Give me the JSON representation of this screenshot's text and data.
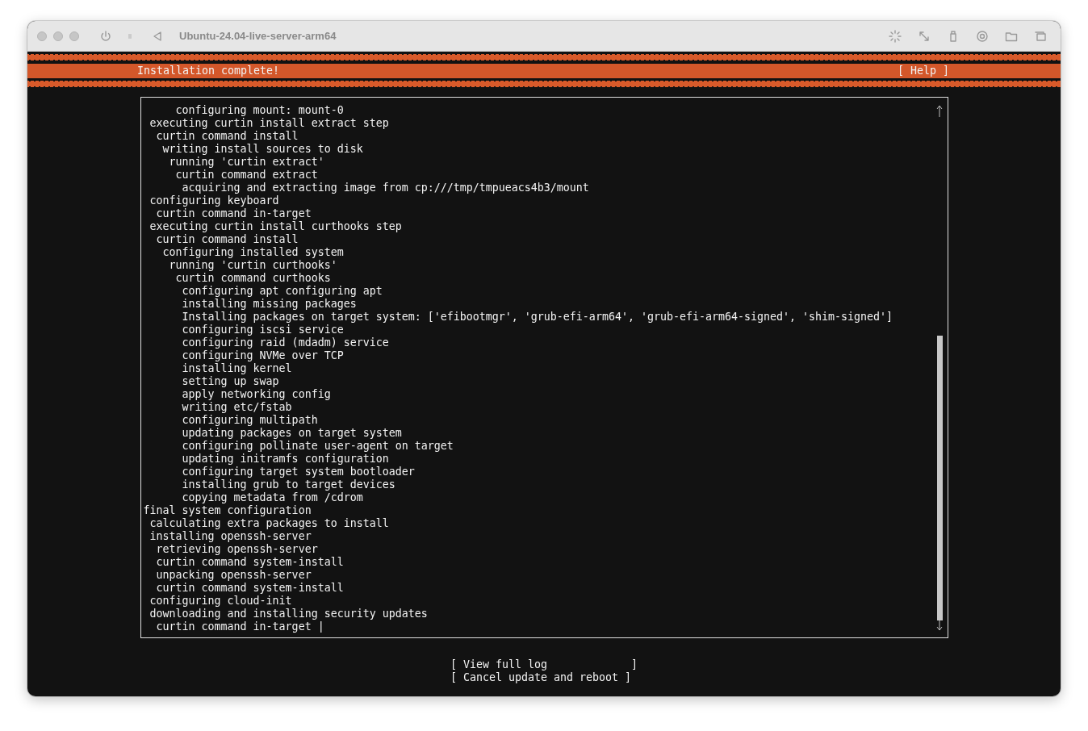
{
  "window": {
    "title": "Ubuntu-24.04-live-server-arm64"
  },
  "header": {
    "title": "Installation complete!",
    "help": "[ Help ]"
  },
  "log": {
    "lines": [
      "     configuring mount: mount-0",
      " executing curtin install extract step",
      "  curtin command install",
      "   writing install sources to disk",
      "    running 'curtin extract'",
      "     curtin command extract",
      "      acquiring and extracting image from cp:///tmp/tmpueacs4b3/mount",
      " configuring keyboard",
      "  curtin command in-target",
      " executing curtin install curthooks step",
      "  curtin command install",
      "   configuring installed system",
      "    running 'curtin curthooks'",
      "     curtin command curthooks",
      "      configuring apt configuring apt",
      "      installing missing packages",
      "      Installing packages on target system: ['efibootmgr', 'grub-efi-arm64', 'grub-efi-arm64-signed', 'shim-signed']",
      "      configuring iscsi service",
      "      configuring raid (mdadm) service",
      "      configuring NVMe over TCP",
      "      installing kernel",
      "      setting up swap",
      "      apply networking config",
      "      writing etc/fstab",
      "      configuring multipath",
      "      updating packages on target system",
      "      configuring pollinate user-agent on target",
      "      updating initramfs configuration",
      "      configuring target system bootloader",
      "      installing grub to target devices",
      "      copying metadata from /cdrom",
      "final system configuration",
      " calculating extra packages to install",
      " installing openssh-server",
      "  retrieving openssh-server",
      "  curtin command system-install",
      "  unpacking openssh-server",
      "  curtin command system-install",
      " configuring cloud-init",
      " downloading and installing security updates",
      "  curtin command in-target |"
    ]
  },
  "buttons": [
    "[ View full log             ]",
    "[ Cancel update and reboot ]"
  ]
}
